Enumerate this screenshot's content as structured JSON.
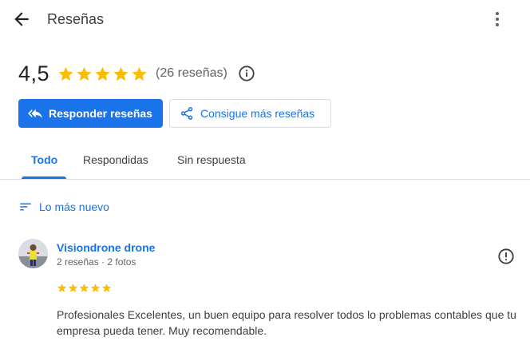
{
  "header": {
    "title": "Reseñas",
    "back_icon": "arrow-back-icon",
    "more_icon": "more-vert-icon"
  },
  "summary": {
    "rating": "4,5",
    "stars": 4.5,
    "review_count_text": "(26 reseñas)",
    "star_color": "#fbbc04"
  },
  "actions": {
    "primary_label": "Responder reseñas",
    "secondary_label": "Consigue más reseñas",
    "accent_color": "#1a73e8"
  },
  "tabs": [
    {
      "label": "Todo",
      "active": true
    },
    {
      "label": "Respondidas",
      "active": false
    },
    {
      "label": "Sin respuesta",
      "active": false
    }
  ],
  "sort": {
    "label": "Lo más nuevo"
  },
  "review": {
    "name": "Visiondrone drone",
    "meta": "2 reseñas · 2 fotos",
    "stars": 5,
    "text": "Profesionales Excelentes, un buen equipo para resolver todos lo problemas contables que tu empresa pueda tener. Muy recomendable."
  }
}
